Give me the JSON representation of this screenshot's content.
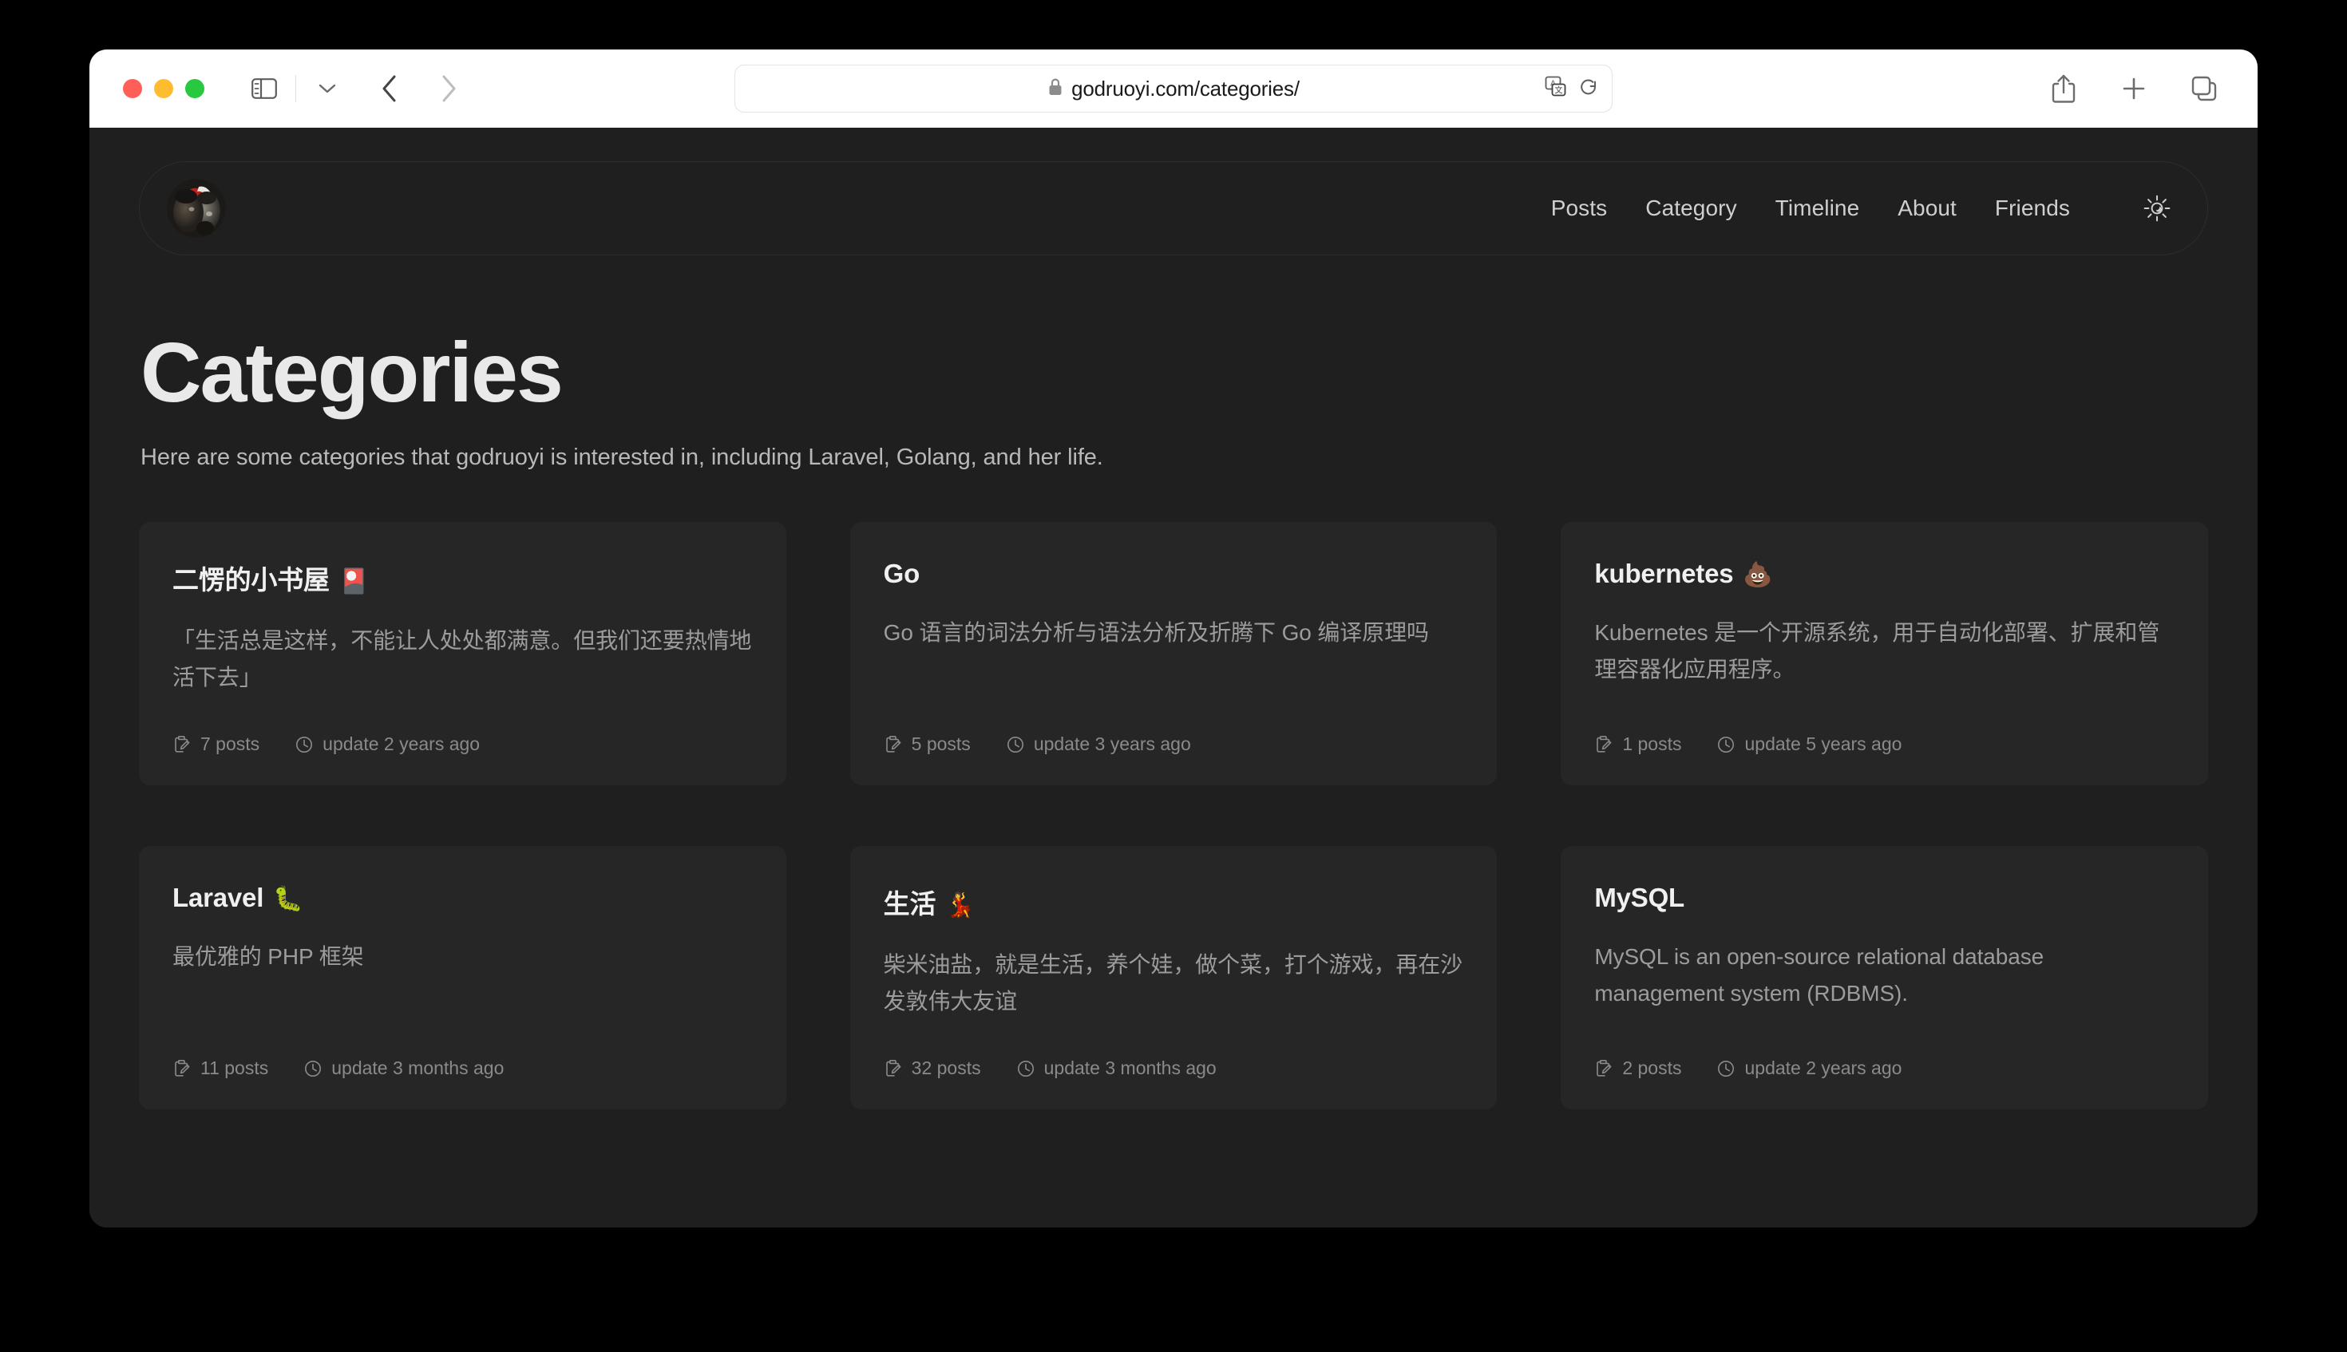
{
  "browser": {
    "url": "godruoyi.com/categories/",
    "icons": {
      "lock": "lock-icon",
      "translate": "translate-icon",
      "reload": "reload-icon",
      "sidebar": "sidebar-toggle-icon",
      "chevron_down": "chevron-down-icon",
      "back": "back-arrow-icon",
      "forward": "forward-arrow-icon",
      "share": "share-icon",
      "new_tab": "plus-icon",
      "tab_overview": "tab-overview-icon"
    },
    "traffic_lights": {
      "close": "#ff5f57",
      "minimize": "#febc2e",
      "maximize": "#28c840"
    }
  },
  "site": {
    "avatar_alt": "avatar",
    "nav": [
      {
        "label": "Posts"
      },
      {
        "label": "Category"
      },
      {
        "label": "Timeline"
      },
      {
        "label": "About"
      },
      {
        "label": "Friends"
      }
    ],
    "theme_toggle_icon": "sun-icon"
  },
  "main": {
    "title": "Categories",
    "subtitle": "Here are some categories that godruoyi is interested in, including Laravel, Golang, and her life.",
    "cards": [
      {
        "title": "二愣的小书屋",
        "emoji": "🎴",
        "description": "「生活总是这样，不能让人处处都满意。但我们还要热情地活下去」",
        "posts": "7 posts",
        "updated": "update 2 years ago"
      },
      {
        "title": "Go",
        "emoji": "",
        "description": "Go 语言的词法分析与语法分析及折腾下 Go 编译原理吗",
        "posts": "5 posts",
        "updated": "update 3 years ago"
      },
      {
        "title": "kubernetes",
        "emoji": "💩",
        "description": "Kubernetes 是一个开源系统，用于自动化部署、扩展和管理容器化应用程序。",
        "posts": "1 posts",
        "updated": "update 5 years ago"
      },
      {
        "title": "Laravel",
        "emoji": "🐛",
        "description": "最优雅的 PHP 框架",
        "posts": "11 posts",
        "updated": "update 3 months ago"
      },
      {
        "title": "生活",
        "emoji": "💃",
        "description": "柴米油盐，就是生活，养个娃，做个菜，打个游戏，再在沙发敦伟大友谊",
        "posts": "32 posts",
        "updated": "update 3 months ago"
      },
      {
        "title": "MySQL",
        "emoji": "",
        "description": "MySQL is an open-source relational database management system (RDBMS).",
        "posts": "2 posts",
        "updated": "update 2 years ago"
      }
    ]
  },
  "colors": {
    "page_bg": "#1f1f1f",
    "card_bg": "#262626",
    "text_primary": "#e9e9e9",
    "text_secondary": "#9c9c9c",
    "text_meta": "#8a8a8a",
    "toolbar_bg": "#ffffff"
  }
}
